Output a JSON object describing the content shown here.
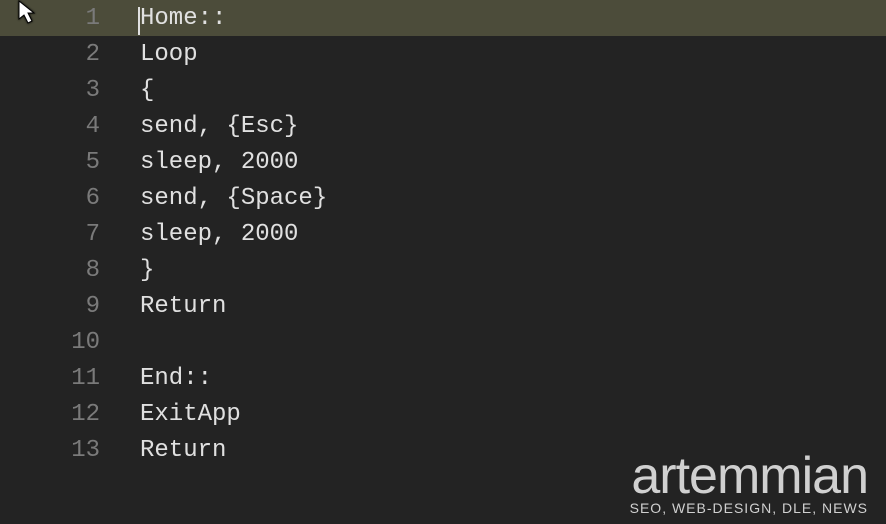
{
  "editor": {
    "active_line": 1,
    "lines": [
      {
        "num": "1",
        "text": "Home::"
      },
      {
        "num": "2",
        "text": "Loop"
      },
      {
        "num": "3",
        "text": "{"
      },
      {
        "num": "4",
        "text": "send, {Esc}"
      },
      {
        "num": "5",
        "text": "sleep, 2000"
      },
      {
        "num": "6",
        "text": "send, {Space}"
      },
      {
        "num": "7",
        "text": "sleep, 2000"
      },
      {
        "num": "8",
        "text": "}"
      },
      {
        "num": "9",
        "text": "Return"
      },
      {
        "num": "10",
        "text": ""
      },
      {
        "num": "11",
        "text": "End::"
      },
      {
        "num": "12",
        "text": "ExitApp"
      },
      {
        "num": "13",
        "text": "Return"
      }
    ]
  },
  "watermark": {
    "title": "artemmian",
    "subtitle": "SEO, WEB-DESIGN, DLE, NEWS"
  }
}
